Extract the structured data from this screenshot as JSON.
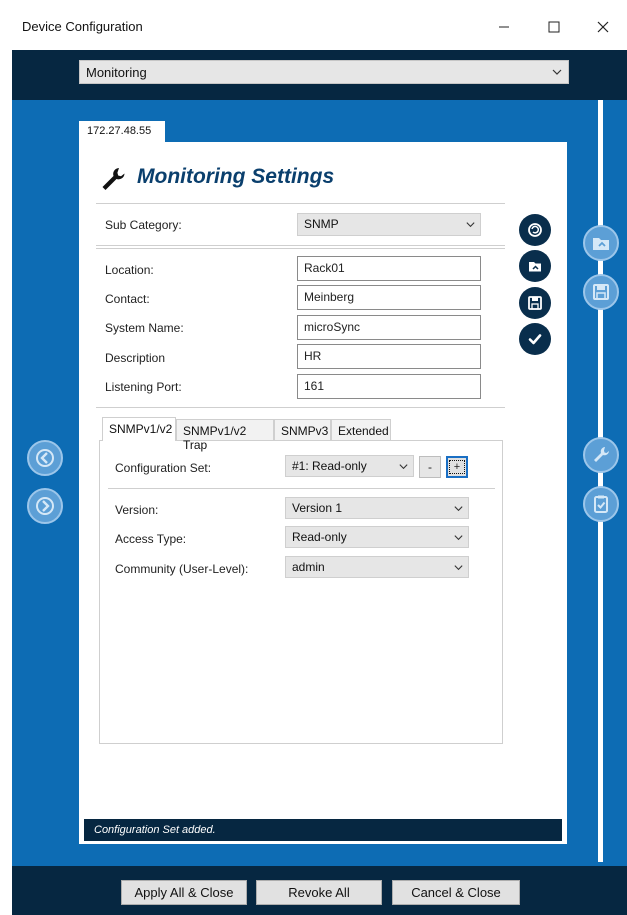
{
  "window": {
    "title": "Device Configuration",
    "controls": {
      "minimize": "—",
      "maximize": "☐",
      "close": "✕"
    }
  },
  "category_select": {
    "value": "Monitoring"
  },
  "device_tab": {
    "label": "172.27.48.55"
  },
  "panel": {
    "heading": "Monitoring Settings",
    "heading_icon": "wrench-icon",
    "sub_category": {
      "label": "Sub Category:",
      "value": "SNMP"
    },
    "fields": [
      {
        "label": "Location:",
        "value": "Rack01"
      },
      {
        "label": "Contact:",
        "value": "Meinberg"
      },
      {
        "label": "System Name:",
        "value": "microSync"
      },
      {
        "label": "Description",
        "value": "HR"
      },
      {
        "label": "Listening Port:",
        "value": "161"
      }
    ],
    "tabs": [
      {
        "label": "SNMPv1/v2",
        "active": true
      },
      {
        "label": "SNMPv1/v2 Trap",
        "active": false
      },
      {
        "label": "SNMPv3",
        "active": false
      },
      {
        "label": "Extended",
        "active": false
      }
    ],
    "tab_content": {
      "config_set": {
        "label": "Configuration Set:",
        "value": "#1: Read-only",
        "minus": "-",
        "plus": "+"
      },
      "version": {
        "label": "Version:",
        "value": "Version 1"
      },
      "access_type": {
        "label": "Access Type:",
        "value": "Read-only"
      },
      "community": {
        "label": "Community (User-Level):",
        "value": "admin"
      }
    }
  },
  "status_text": "Configuration Set added.",
  "side_buttons": {
    "panel_right": [
      "reset-icon",
      "load-profile-icon",
      "save-icon",
      "check-icon"
    ],
    "frame_right": [
      "load-folder-icon",
      "save-disk-icon",
      "wrench-icon",
      "clipboard-check-icon"
    ],
    "frame_left": [
      "previous-icon",
      "next-icon"
    ]
  },
  "footer": {
    "apply_all": "Apply All & Close",
    "revoke_all": "Revoke All",
    "cancel_close": "Cancel & Close"
  },
  "colors": {
    "dark_navy": "#062741",
    "frame_blue": "#0d6cb4",
    "heading_blue": "#0a3f6d"
  }
}
